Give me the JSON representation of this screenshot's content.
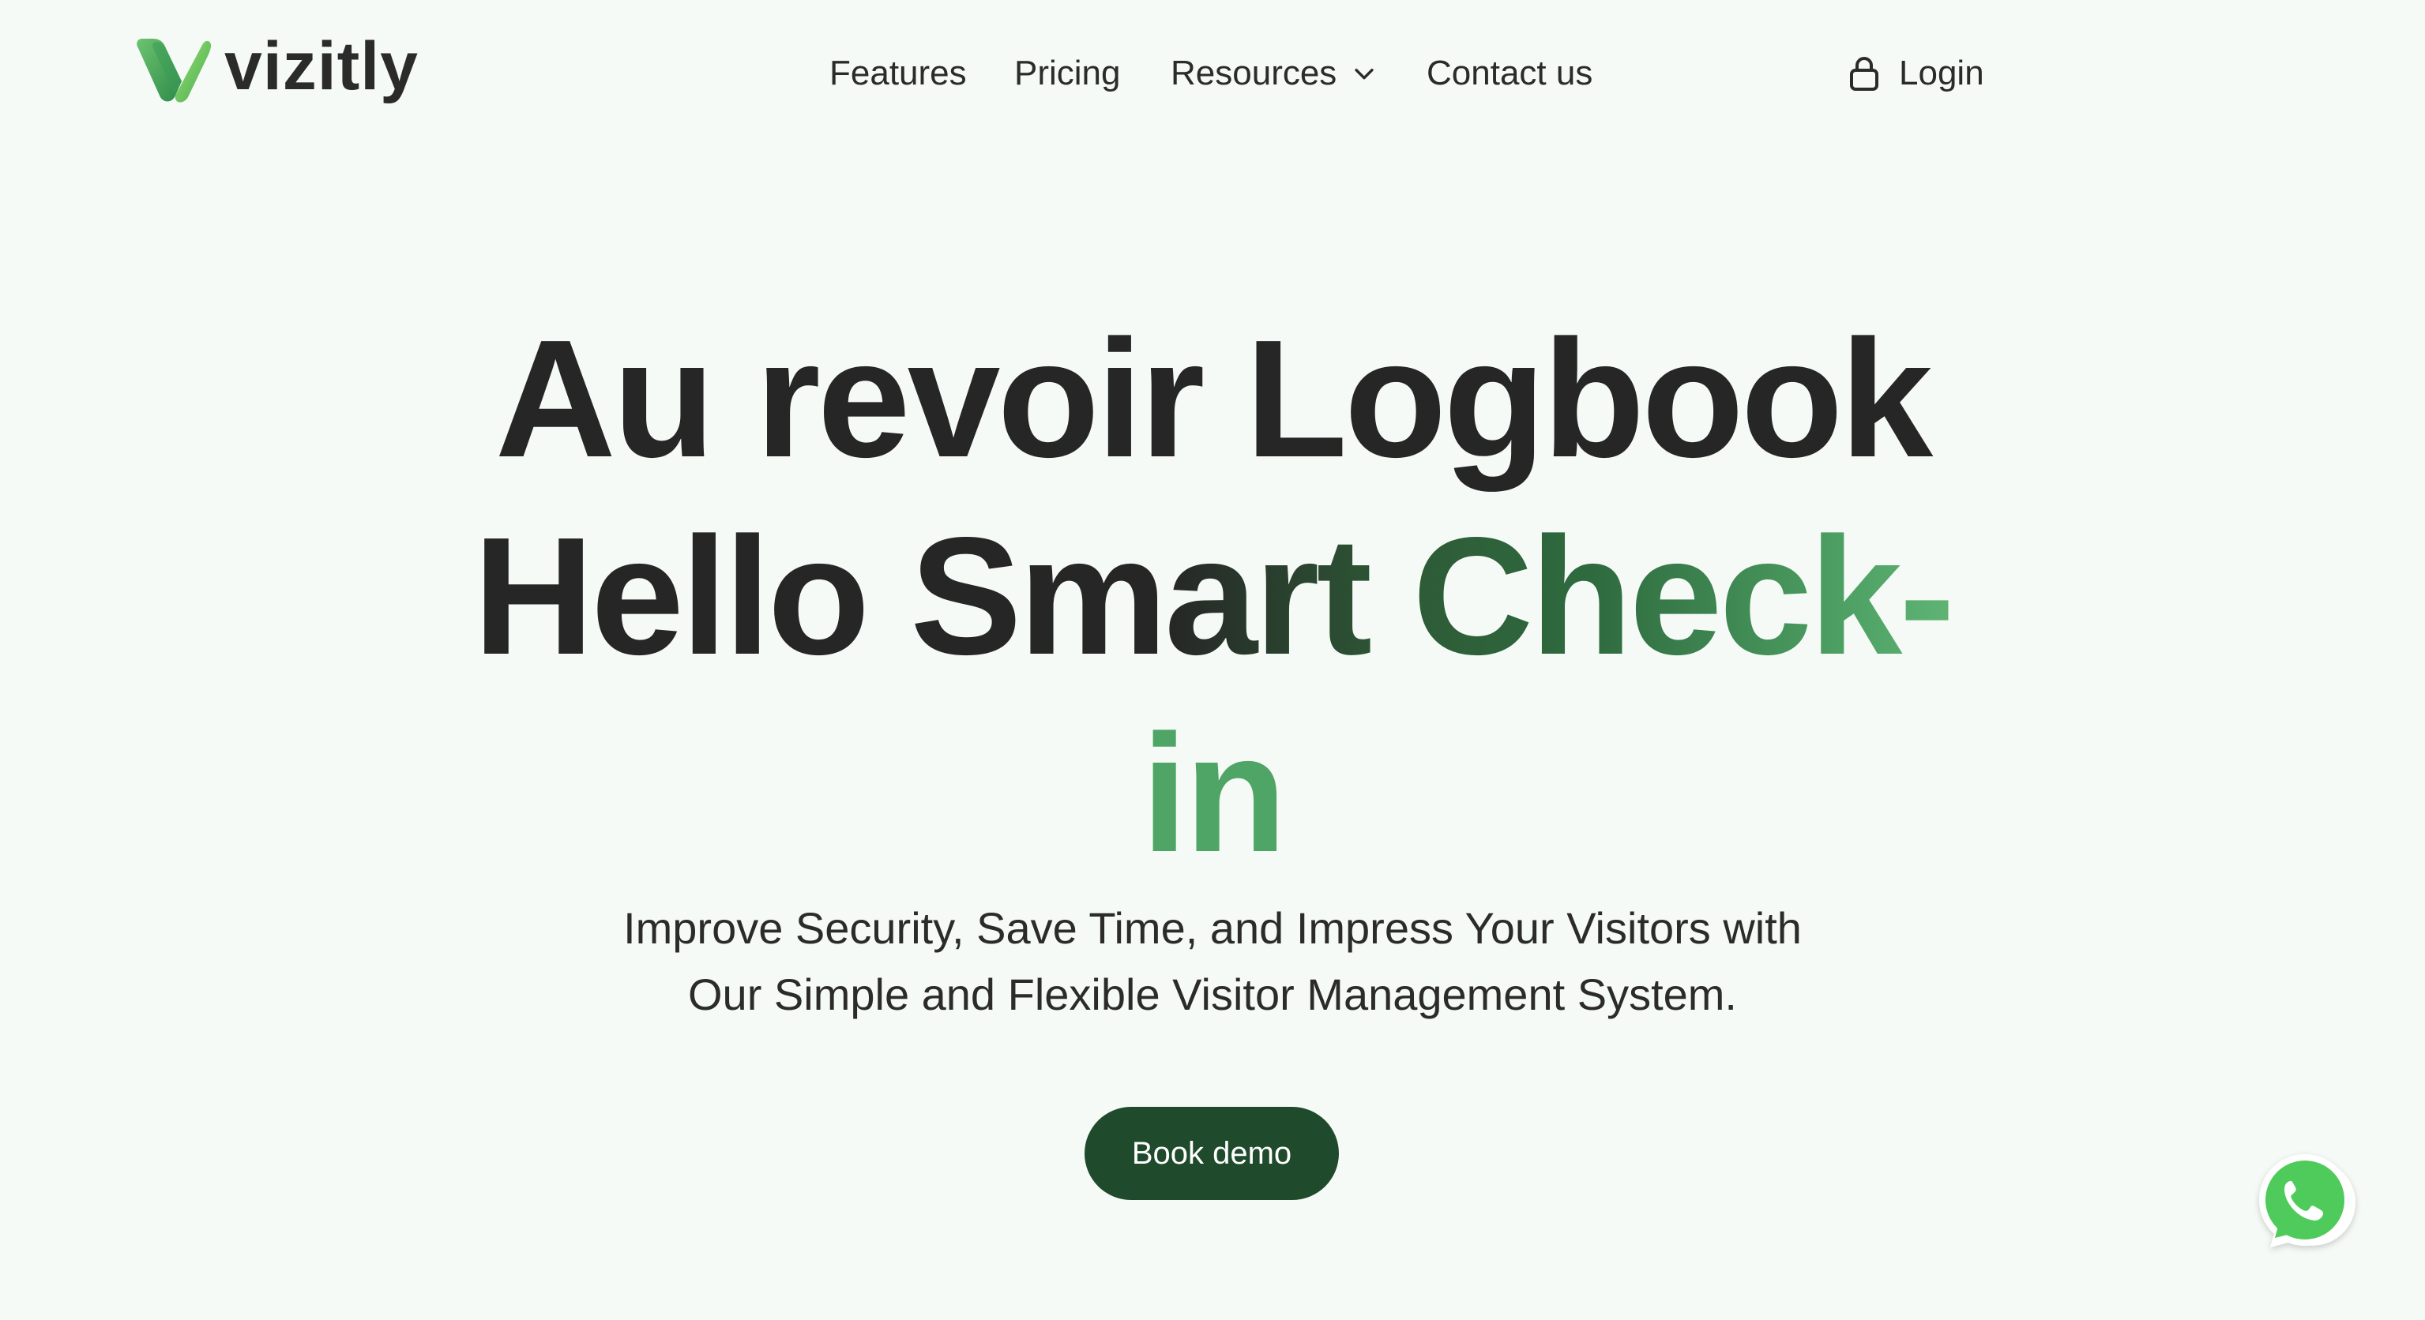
{
  "brand": {
    "name": "vizitly",
    "accent_dark": "#1f4a2b",
    "accent_green": "#4fa566"
  },
  "nav": {
    "items": [
      {
        "label": "Features"
      },
      {
        "label": "Pricing"
      },
      {
        "label": "Resources",
        "has_dropdown": true
      },
      {
        "label": "Contact us"
      }
    ],
    "login_label": "Login"
  },
  "hero": {
    "line1": "Au revoir Logbook",
    "line2_plain": "Hello Sm",
    "line2_accent": "art Check-",
    "line3_accent": "in",
    "subtitle_line1": "Improve Security, Save Time, and Impress Your Visitors with",
    "subtitle_line2": "Our Simple and Flexible Visitor Management System.",
    "cta_label": "Book demo"
  },
  "icons": {
    "logo": "vizitly-v-logo-icon",
    "dropdown": "chevron-down-icon",
    "login": "lock-icon",
    "chat": "whatsapp-icon"
  }
}
